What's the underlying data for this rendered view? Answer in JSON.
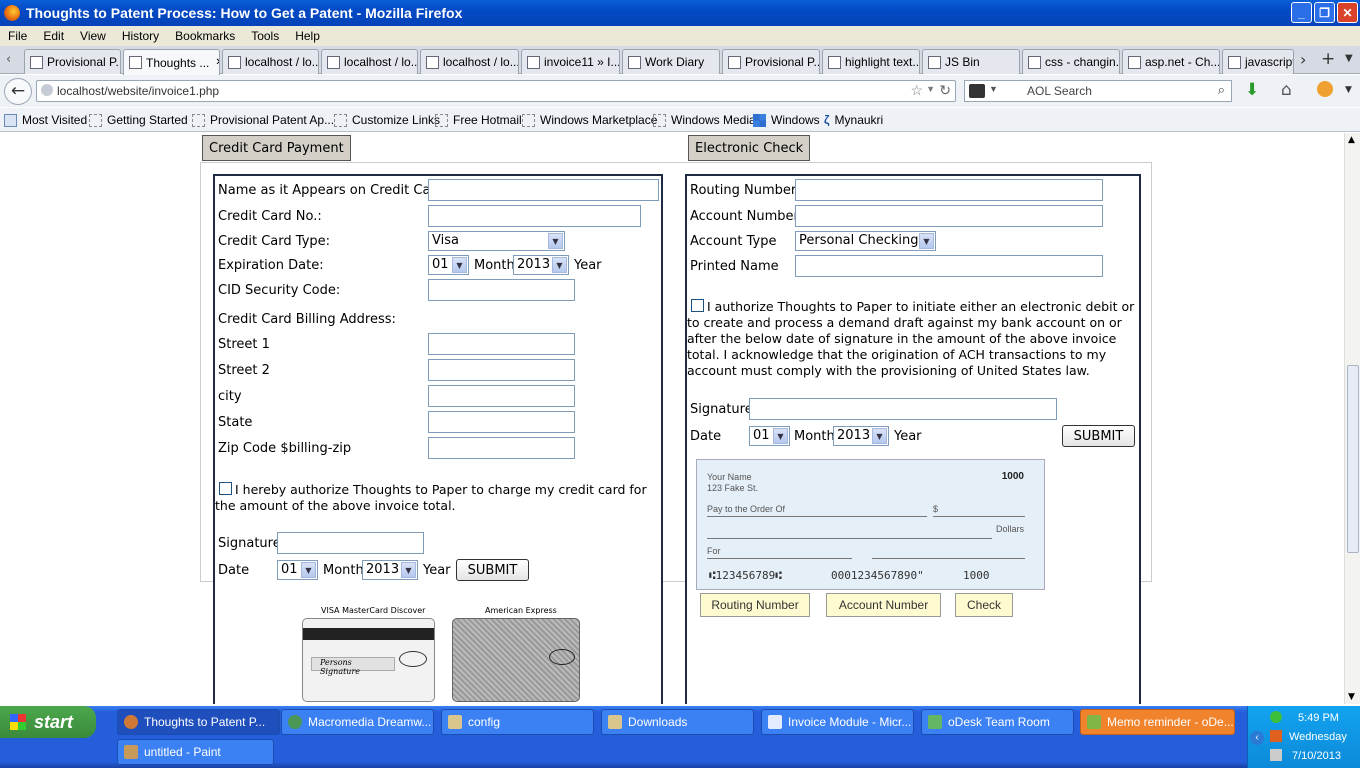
{
  "window": {
    "title": "Thoughts to Patent Process: How to Get a Patent - Mozilla Firefox"
  },
  "menu": [
    "File",
    "Edit",
    "View",
    "History",
    "Bookmarks",
    "Tools",
    "Help"
  ],
  "tabs": [
    "Provisional P...",
    "Thoughts ...",
    "localhost / lo...",
    "localhost / lo...",
    "localhost / lo...",
    "invoice11 » I...",
    "Work Diary",
    "Provisional P...",
    "highlight text...",
    "JS Bin",
    "css - changin...",
    "asp.net - Ch...",
    "javascript"
  ],
  "nav": {
    "url": "localhost/website/invoice1.php",
    "search_placeholder": "AOL Search"
  },
  "bookmarks": [
    "Most Visited",
    "Getting Started",
    "Provisional Patent Ap...",
    "Customize Links",
    "Free Hotmail",
    "Windows Marketplace",
    "Windows Media",
    "Windows",
    "Mynaukri"
  ],
  "credit": {
    "section_title": "Credit Card Payment",
    "name_label": "Name as it Appears on Credit Card:",
    "cardno_label": "Credit Card No.:",
    "type_label": "Credit Card Type:",
    "type_value": "Visa",
    "exp_label": "Expiration Date:",
    "exp_month": "01",
    "month_word": "Month",
    "exp_year": "2013",
    "year_word": "Year",
    "cid_label": "CID Security Code:",
    "billing_label": "Credit Card Billing Address:",
    "street1": "Street 1",
    "street2": "Street 2",
    "city": "city",
    "state": "State",
    "zip": "Zip Code $billing-zip",
    "authorize": "I hereby authorize Thoughts to Paper to charge my credit card for the amount of the above invoice total.",
    "signature_label": "Signature",
    "date_label": "Date",
    "date_month": "01",
    "date_year": "2013",
    "submit": "SUBMIT",
    "card_caption_left": "VISA  MasterCard  Discover",
    "card_caption_right": "American Express",
    "card_signature": "Persons Signature"
  },
  "echeck": {
    "section_title": "Electronic Check",
    "routing_label": "Routing Number:",
    "account_label": "Account Number:",
    "acct_type_label": "Account Type",
    "acct_type_value": "Personal Checking",
    "printed_label": "Printed Name",
    "authorize": "I authorize Thoughts to Paper to initiate either an electronic debit or to create and process a demand draft against my bank account on or after the below date of signature in the amount of the above invoice total. I acknowledge that the origination of ACH transactions to my account must comply with the provisioning of United States law.",
    "signature_label": "Signature",
    "date_label": "Date",
    "date_month": "01",
    "month_word": "Month",
    "date_year": "2013",
    "year_word": "Year",
    "submit": "SUBMIT",
    "check_name": "Your Name",
    "check_addr": "123 Fake St.",
    "check_num": "1000",
    "check_pay": "Pay to the Order Of",
    "check_dollar_sign": "$",
    "check_dollars": "Dollars",
    "check_for": "For",
    "check_micr_routing": "⑆123456789⑆",
    "check_micr_account": "0001234567890\"",
    "check_micr_num": "1000",
    "callout_routing": "Routing Number",
    "callout_account": "Account Number",
    "callout_check": "Check"
  },
  "taskbar": {
    "start": "start",
    "items": [
      "Thoughts to Patent P...",
      "Macromedia Dreamw...",
      "config",
      "Downloads",
      "Invoice Module - Micr...",
      "oDesk Team Room",
      "Memo reminder - oDe...",
      "untitled - Paint"
    ],
    "time": "5:49 PM",
    "day": "Wednesday",
    "date": "7/10/2013"
  }
}
